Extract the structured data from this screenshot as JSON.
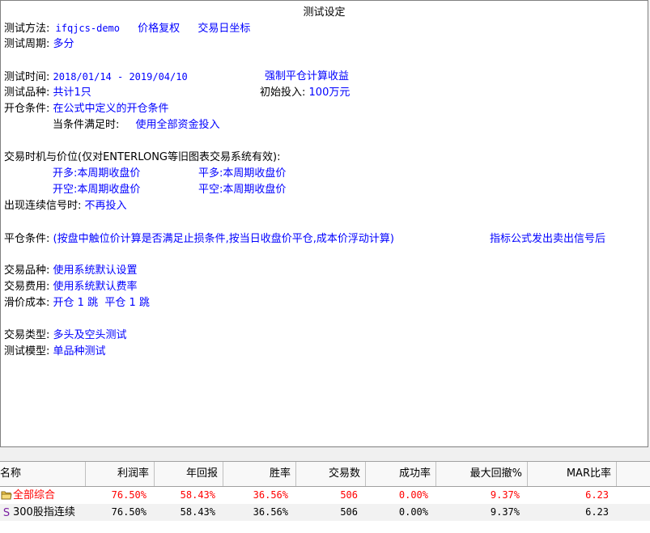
{
  "report": {
    "title": "测试设定",
    "method_label": "测试方法:",
    "method_value": "ifqjcs-demo",
    "price_adj": "价格复权",
    "coords": "交易日坐标",
    "period_label": "测试周期:",
    "period_value": "多分",
    "time_label": "测试时间:",
    "time_value": "2018/01/14 - 2019/04/10",
    "force_close": "强制平仓计算收益",
    "variety_label": "测试品种:",
    "variety_value": "共计1只",
    "initial_label": "初始投入:",
    "initial_value": "100万元",
    "open_label": "开仓条件:",
    "open_value": "在公式中定义的开仓条件",
    "when_label": "当条件满足时:",
    "when_value": "使用全部资金投入",
    "timing_label": "交易时机与价位(仅对ENTERLONG等旧图表交易系统有效):",
    "open_long": "开多:本周期收盘价",
    "close_long": "平多:本周期收盘价",
    "open_short": "开空:本周期收盘价",
    "close_short": "平空:本周期收盘价",
    "consecutive_label": "出现连续信号时:",
    "consecutive_value": "不再投入",
    "close_cond_label": "平仓条件:",
    "close_cond_value": "(按盘中触位价计算是否满足止损条件,按当日收盘价平仓,成本价浮动计算)",
    "close_cond_extra": "指标公式发出卖出信号后",
    "trade_variety_label": "交易品种:",
    "trade_variety_value": "使用系统默认设置",
    "fee_label": "交易费用:",
    "fee_value": "使用系统默认费率",
    "slip_label": "滑价成本:",
    "slip_value": "开仓 1 跳  平仓 1 跳",
    "type_label": "交易类型:",
    "type_value": "多头及空头测试",
    "model_label": "测试模型:",
    "model_value": "单品种测试"
  },
  "table": {
    "headers": [
      "名称",
      "利润率",
      "年回报",
      "胜率",
      "交易数",
      "成功率",
      "最大回撤%",
      "MAR比率"
    ],
    "rows": [
      {
        "icon": "folder-icon",
        "name": "全部综合",
        "values": [
          "76.50%",
          "58.43%",
          "36.56%",
          "506",
          "0.00%",
          "9.37%",
          "6.23"
        ],
        "color": "#ff0000"
      },
      {
        "icon": "stock-s-icon",
        "name": "300股指连续",
        "values": [
          "76.50%",
          "58.43%",
          "36.56%",
          "506",
          "0.00%",
          "9.37%",
          "6.23"
        ],
        "color": "#000000"
      }
    ]
  }
}
